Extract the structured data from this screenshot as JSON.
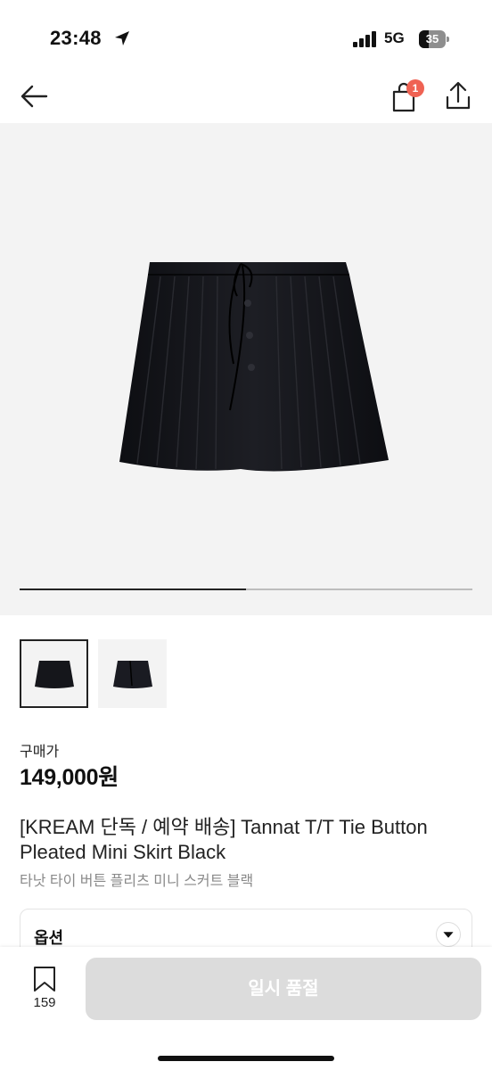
{
  "status": {
    "time": "23:48",
    "network": "5G",
    "battery": "35",
    "battery_level": 0.35
  },
  "nav": {
    "cart_badge": "1"
  },
  "gallery": {
    "progress": 0.5,
    "thumbnail_count": 2,
    "active_thumbnail": 0
  },
  "price": {
    "label": "구매가",
    "value": "149,000원"
  },
  "product": {
    "title": "[KREAM 단독 / 예약 배송] Tannat T/T Tie Button Pleated Mini Skirt Black",
    "subtitle": "타낫 타이 버튼 플리츠 미니 스커트 블랙"
  },
  "option": {
    "label": "옵션"
  },
  "bottom": {
    "bookmark_count": "159",
    "action_label": "일시 품절"
  },
  "icons": {
    "back": "arrow-left-icon",
    "cart": "shopping-bag-icon",
    "share": "share-icon",
    "bookmark": "bookmark-icon",
    "option": "chevron-down-icon"
  },
  "colors": {
    "badge": "#ef6253",
    "disabled_button": "#dcdcdc",
    "gallery_bg": "#f3f3f3"
  }
}
